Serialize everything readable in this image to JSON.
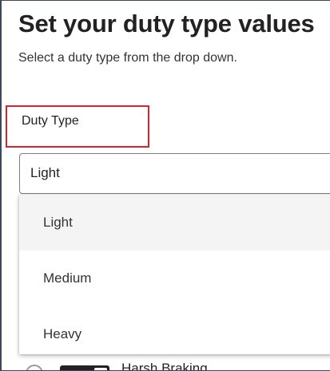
{
  "page": {
    "title": "Set your duty type values",
    "subtitle": "Select a duty type from the drop down."
  },
  "duty_type": {
    "label": "Duty Type",
    "selected_value": "Light",
    "options": [
      {
        "label": "Light",
        "selected": true
      },
      {
        "label": "Medium",
        "selected": false
      },
      {
        "label": "Heavy",
        "selected": false
      }
    ]
  },
  "behind_row": {
    "label": "Harsh Braking"
  },
  "colors": {
    "highlight": "#d9232e",
    "toggle_on": "#222222",
    "selected_option_bg": "#f4f4f4"
  }
}
